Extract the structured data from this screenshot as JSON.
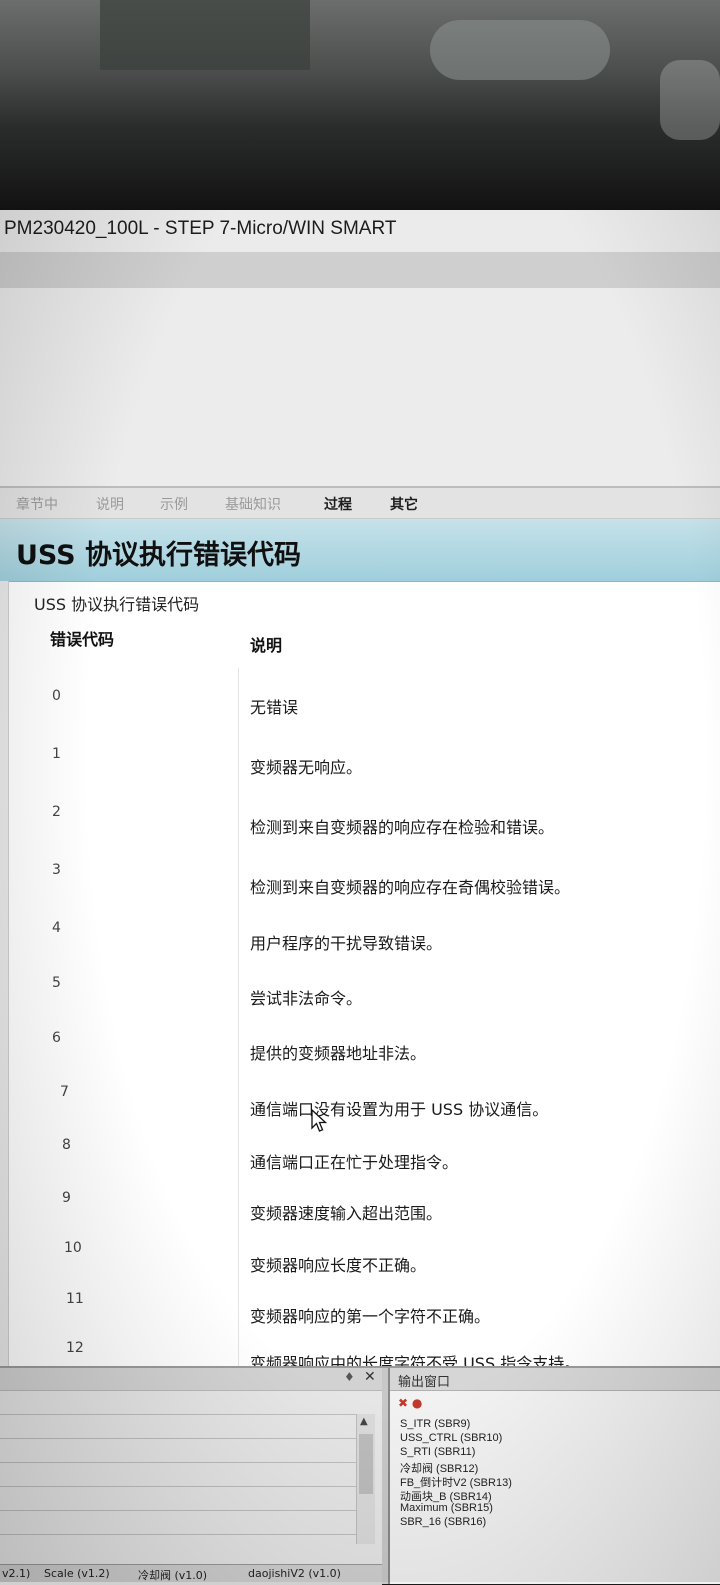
{
  "window": {
    "title": "PM230420_100L - STEP 7-Micro/WIN SMART"
  },
  "help": {
    "tabs": [
      {
        "label": "章节中",
        "active": false
      },
      {
        "label": "说明",
        "active": false
      },
      {
        "label": "示例",
        "active": false
      },
      {
        "label": "基础知识",
        "active": false
      },
      {
        "label": "过程",
        "active": true
      },
      {
        "label": "其它",
        "active": true
      }
    ],
    "header_title": "USS 协议执行错误代码",
    "subtitle": "USS 协议执行错误代码",
    "columns": {
      "code": "错误代码",
      "description": "说明"
    },
    "rows": [
      {
        "code": "0",
        "desc": "无错误"
      },
      {
        "code": "1",
        "desc": "变频器无响应。"
      },
      {
        "code": "2",
        "desc": "检测到来自变频器的响应存在检验和错误。"
      },
      {
        "code": "3",
        "desc": "检测到来自变频器的响应存在奇偶校验错误。"
      },
      {
        "code": "4",
        "desc": "用户程序的干扰导致错误。"
      },
      {
        "code": "5",
        "desc": "尝试非法命令。"
      },
      {
        "code": "6",
        "desc": "提供的变频器地址非法。"
      },
      {
        "code": "7",
        "desc": "通信端口没有设置为用于 USS 协议通信。"
      },
      {
        "code": "8",
        "desc": "通信端口正在忙于处理指令。"
      },
      {
        "code": "9",
        "desc": "变频器速度输入超出范围。"
      },
      {
        "code": "10",
        "desc": "变频器响应长度不正确。"
      },
      {
        "code": "11",
        "desc": "变频器响应的第一个字符不正确。"
      },
      {
        "code": "12",
        "desc": "变频器响应中的长度字符不受 USS 指令支持。"
      }
    ]
  },
  "bottom_tabs": [
    {
      "label": "v2.1)"
    },
    {
      "label": "Scale (v1.2)"
    },
    {
      "label": "冷却阀 (v1.0)"
    },
    {
      "label": "daojishiV2 (v1.0)"
    }
  ],
  "output": {
    "title": "输出窗口",
    "lines": [
      "S_ITR (SBR9)",
      "USS_CTRL (SBR10)",
      "S_RTI (SBR11)",
      "冷却阀 (SBR12)",
      "FB_倒计时V2 (SBR13)",
      "动画块_B (SBR14)",
      "Maximum (SBR15)",
      "SBR_16 (SBR16)"
    ]
  },
  "panel": {
    "pin_glyph": "♦",
    "close_glyph": "✕",
    "scroll_up_glyph": "▲"
  },
  "colors": {
    "header_bg": "#a9d4df",
    "window_bg": "#ffffff",
    "titlebar_bg": "#ebebeb"
  }
}
